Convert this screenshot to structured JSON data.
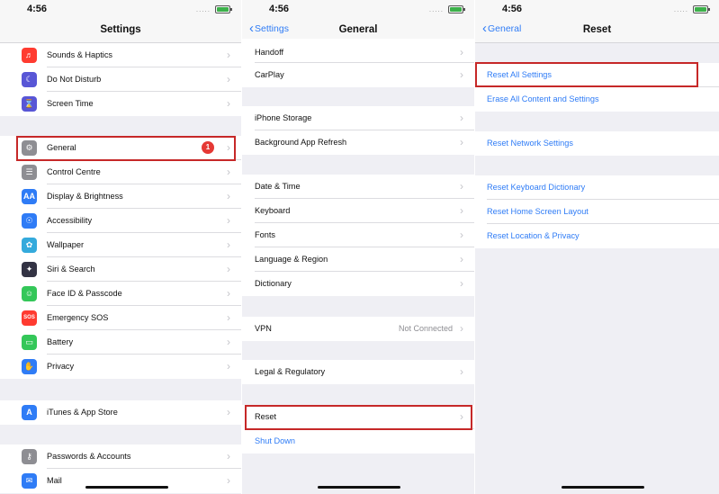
{
  "status": {
    "time": "4:56",
    "signal": "....."
  },
  "screens": {
    "settings": {
      "title": "Settings",
      "items": [
        {
          "label": "Sounds & Haptics",
          "icon": "speaker-icon",
          "color": "#ff3b30"
        },
        {
          "label": "Do Not Disturb",
          "icon": "moon-icon",
          "color": "#5856d6"
        },
        {
          "label": "Screen Time",
          "icon": "hourglass-icon",
          "color": "#5856d6"
        },
        {
          "label": "General",
          "icon": "gear-icon",
          "color": "#8e8e93",
          "badge": "1"
        },
        {
          "label": "Control Centre",
          "icon": "toggles-icon",
          "color": "#8e8e93"
        },
        {
          "label": "Display & Brightness",
          "icon": "aa-icon",
          "color": "#2f7cf6"
        },
        {
          "label": "Accessibility",
          "icon": "accessibility-icon",
          "color": "#2f7cf6"
        },
        {
          "label": "Wallpaper",
          "icon": "flower-icon",
          "color": "#34aadc"
        },
        {
          "label": "Siri & Search",
          "icon": "siri-icon",
          "color": "#333344"
        },
        {
          "label": "Face ID & Passcode",
          "icon": "face-id-icon",
          "color": "#34c759"
        },
        {
          "label": "Emergency SOS",
          "icon": "sos-icon",
          "color": "#ff3b30"
        },
        {
          "label": "Battery",
          "icon": "battery-icon",
          "color": "#34c759"
        },
        {
          "label": "Privacy",
          "icon": "hand-icon",
          "color": "#2f7cf6"
        },
        {
          "label": "iTunes & App Store",
          "icon": "app-store-icon",
          "color": "#2f7cf6"
        },
        {
          "label": "Passwords & Accounts",
          "icon": "key-icon",
          "color": "#8e8e93"
        },
        {
          "label": "Mail",
          "icon": "mail-icon",
          "color": "#2f7cf6"
        }
      ]
    },
    "general": {
      "back_label": "Settings",
      "title": "General",
      "items": [
        {
          "label": "Handoff"
        },
        {
          "label": "CarPlay"
        },
        {
          "label": "iPhone Storage"
        },
        {
          "label": "Background App Refresh"
        },
        {
          "label": "Date & Time"
        },
        {
          "label": "Keyboard"
        },
        {
          "label": "Fonts"
        },
        {
          "label": "Language & Region"
        },
        {
          "label": "Dictionary"
        },
        {
          "label": "VPN",
          "value": "Not Connected"
        },
        {
          "label": "Legal & Regulatory"
        },
        {
          "label": "Reset"
        },
        {
          "label": "Shut Down"
        }
      ]
    },
    "reset": {
      "back_label": "General",
      "title": "Reset",
      "items": [
        {
          "label": "Reset All Settings"
        },
        {
          "label": "Erase All Content and Settings"
        },
        {
          "label": "Reset Network Settings"
        },
        {
          "label": "Reset Keyboard Dictionary"
        },
        {
          "label": "Reset Home Screen Layout"
        },
        {
          "label": "Reset Location & Privacy"
        }
      ]
    }
  }
}
